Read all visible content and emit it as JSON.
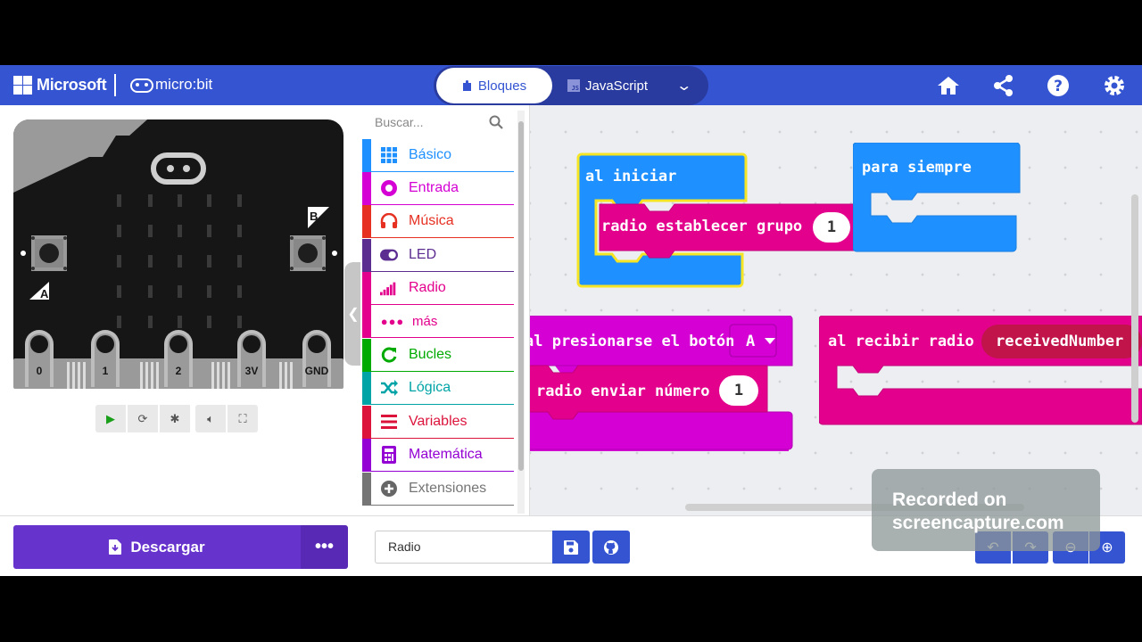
{
  "header": {
    "brand": "Microsoft",
    "product": "micro:bit",
    "tab_blocks": "Bloques",
    "tab_js": "JavaScript",
    "js_badge": "JS",
    "icons": [
      "home-icon",
      "share-icon",
      "help-icon",
      "settings-icon"
    ]
  },
  "simulator": {
    "button_a": "A",
    "button_b": "B",
    "pins": [
      "0",
      "1",
      "2",
      "3V",
      "GND"
    ],
    "controls": [
      "play-icon",
      "restart-icon",
      "debug-icon",
      "mute-icon",
      "fullscreen-icon"
    ],
    "collapse_icon": "chevron-left-icon"
  },
  "toolbox": {
    "search_placeholder": "Buscar...",
    "categories": [
      {
        "label": "Básico",
        "color": "#1e90ff"
      },
      {
        "label": "Entrada",
        "color": "#d400d4"
      },
      {
        "label": "Música",
        "color": "#e63022"
      },
      {
        "label": "LED",
        "color": "#5c2d91"
      },
      {
        "label": "Radio",
        "color": "#e3008c"
      },
      {
        "label": "más",
        "color": "#e3008c"
      },
      {
        "label": "Bucles",
        "color": "#00aa00"
      },
      {
        "label": "Lógica",
        "color": "#00a4a6"
      },
      {
        "label": "Variables",
        "color": "#dc143c"
      },
      {
        "label": "Matemática",
        "color": "#9400d3"
      },
      {
        "label": "Extensiones",
        "color": "#757575"
      }
    ]
  },
  "workspace": {
    "on_start": {
      "label": "al iniciar",
      "inner": "radio establecer grupo",
      "value": "1",
      "color": "#1e90ff"
    },
    "forever": {
      "label": "para siempre",
      "color": "#1e90ff"
    },
    "button_pressed": {
      "label": "al presionarse el botón",
      "dropdown": "A",
      "inner": "radio enviar número",
      "value": "1",
      "color": "#d400d4"
    },
    "on_received": {
      "label": "al recibir radio",
      "param": "receivedNumber",
      "color": "#e3008c"
    }
  },
  "bottom": {
    "download_label": "Descargar",
    "more_label": "•••",
    "project_name": "Radio",
    "workspace_buttons": [
      "undo-icon",
      "redo-icon",
      "zoom-out-icon",
      "zoom-in-icon"
    ]
  },
  "watermark": {
    "line1": "Recorded on",
    "line2": "screencapture.com"
  }
}
